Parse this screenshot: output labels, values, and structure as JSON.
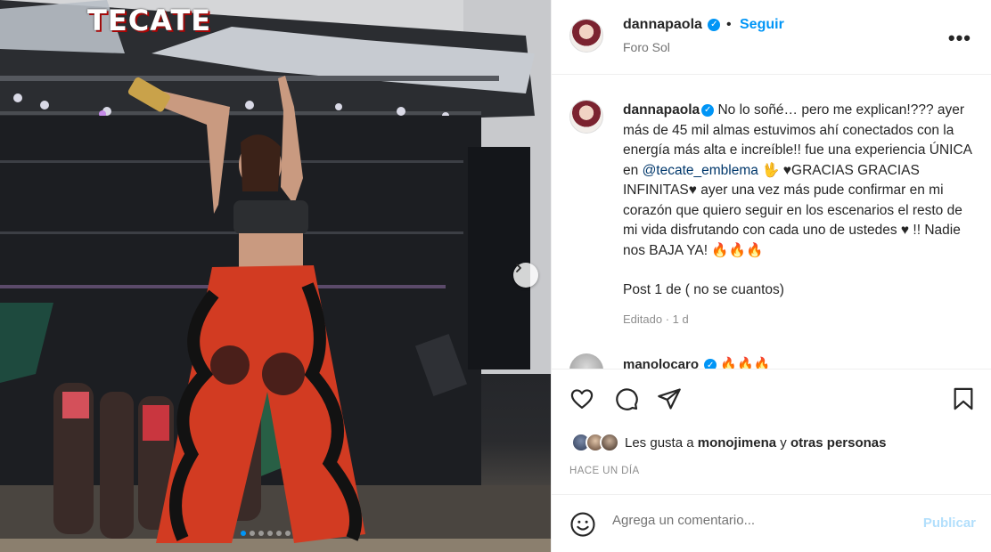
{
  "photo": {
    "stage_logo": "TECATE",
    "carousel_dots": 6,
    "active_dot": 0
  },
  "post": {
    "username": "dannapaola",
    "follow_label": "Seguir",
    "separator": "•",
    "location": "Foro Sol",
    "more_label": "•••"
  },
  "caption": {
    "username": "dannapaola",
    "text_before_mention": "No lo soñé… pero me explican!??? ayer más de 45 mil almas estuvimos ahí conectados con la energía más alta e increíble!! fue una experiencia ÚNICA en",
    "mention": "@tecate_emblema",
    "text_after_mention": "🖖 ♥GRACIAS GRACIAS INFINITAS♥ ayer una vez más pude confirmar en mi corazón que quiero seguir en los escenarios el resto de mi vida disfrutando con cada uno de ustedes ♥ !! Nadie nos BAJA YA! 🔥🔥🔥",
    "post_line": "Post 1 de ( no se cuantos)",
    "edited": "Editado · 1 d"
  },
  "comment2": {
    "username": "manolocaro",
    "text": "🔥🔥🔥"
  },
  "likes": {
    "prefix": "Les gusta a",
    "user": "monojimena",
    "joiner": "y",
    "others": "otras personas"
  },
  "timestamp": "HACE UN DÍA",
  "add_comment": {
    "placeholder": "Agrega un comentario...",
    "publish_label": "Publicar"
  },
  "colors": {
    "accent": "#0095f6",
    "publish_disabled": "#b2dffc",
    "mention": "#00376b",
    "secondary_text": "#737373"
  }
}
